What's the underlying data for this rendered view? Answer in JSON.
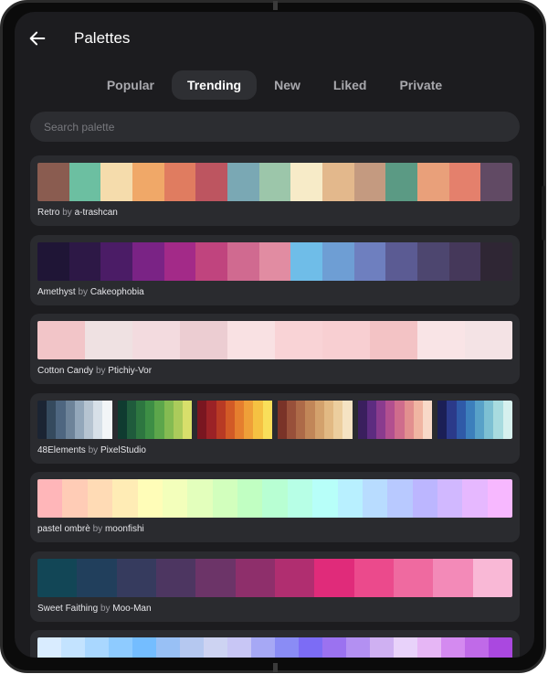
{
  "header": {
    "title": "Palettes"
  },
  "tabs": [
    {
      "label": "Popular",
      "active": false
    },
    {
      "label": "Trending",
      "active": true
    },
    {
      "label": "New",
      "active": false
    },
    {
      "label": "Liked",
      "active": false
    },
    {
      "label": "Private",
      "active": false
    }
  ],
  "search": {
    "placeholder": "Search palette",
    "value": ""
  },
  "by_word": "by",
  "palettes": [
    {
      "name": "Retro",
      "author": "a-trashcan",
      "groups": [
        [
          "#8a5c50",
          "#6cbfa1",
          "#f5dcac",
          "#f0a868",
          "#e07c60",
          "#bd5560",
          "#7aa8b4",
          "#9cc6aa",
          "#f7ebc8",
          "#e3b88c",
          "#c49a80",
          "#5b9a84",
          "#e9a07a",
          "#e4806c",
          "#614a64"
        ]
      ]
    },
    {
      "name": "Amethyst",
      "author": "Cakeophobia",
      "groups": [
        [
          "#1f1536",
          "#2d1846",
          "#4b1c66",
          "#7a2385",
          "#a32a88",
          "#c0447e",
          "#d06a90",
          "#e18ca2",
          "#6fbde8",
          "#6e9ed4",
          "#6e7fbf",
          "#5b5b93",
          "#4d466f",
          "#45385a",
          "#2f2634"
        ]
      ]
    },
    {
      "name": "Cotton Candy",
      "author": "Ptichiy-Vor",
      "groups": [
        [
          "#f2c5c8",
          "#efe1e2",
          "#f3dbdf",
          "#eccdd2",
          "#f9e1e3",
          "#f9d3d6",
          "#f8cfd2",
          "#f3c3c5",
          "#f9e4e6",
          "#f4e3e5"
        ]
      ]
    },
    {
      "name": "48Elements",
      "author": "PixelStudio",
      "groups": [
        [
          "#1b2433",
          "#354a5e",
          "#4e6680",
          "#6d8399",
          "#93a7ba",
          "#b6c4d1",
          "#d7e0e8",
          "#f2f5f7"
        ],
        [
          "#0f3b30",
          "#1f5b3c",
          "#2d7640",
          "#3d8e45",
          "#5ca64b",
          "#84bb52",
          "#abcb5b",
          "#d8df6b"
        ],
        [
          "#7a1620",
          "#9b2226",
          "#b83a24",
          "#d25a26",
          "#e57e2e",
          "#ef9f38",
          "#f5c142",
          "#f9df5a"
        ],
        [
          "#7a3328",
          "#98503a",
          "#ad6a48",
          "#c18658",
          "#d3a16c",
          "#e2b983",
          "#ecce9e",
          "#f5e3c3"
        ],
        [
          "#3a1f5e",
          "#5d2c80",
          "#8a3b8e",
          "#b24f8f",
          "#cf6c8c",
          "#e28f8f",
          "#f0b5a2",
          "#f8d9c8"
        ],
        [
          "#1b1f56",
          "#2b3a8a",
          "#2f5aa8",
          "#3c7fbc",
          "#58a1c8",
          "#7dc0d3",
          "#a8dbdf",
          "#d6f0ee"
        ]
      ]
    },
    {
      "name": "pastel ombrè",
      "author": "moonfishi",
      "groups": [
        [
          "#ffb6b9",
          "#ffccb6",
          "#ffdbb5",
          "#ffecb5",
          "#fffdb8",
          "#f3ffbb",
          "#e3ffbc",
          "#d2ffbd",
          "#c1ffc2",
          "#b8ffd3",
          "#b7ffe6",
          "#b7fff9",
          "#b8f0ff",
          "#b8dcff",
          "#b8c9ff",
          "#bcb6ff",
          "#d1b8ff",
          "#e6b8ff",
          "#f7b8ff"
        ]
      ]
    },
    {
      "name": "Sweet Faithing",
      "author": "Moo-Man",
      "groups": [
        [
          "#124656",
          "#213f5c",
          "#363b5e",
          "#4d3661",
          "#6c3468",
          "#8e2f6b",
          "#b02e70",
          "#e02b7a",
          "#eb4a8c",
          "#ef6aa0",
          "#f38ab8",
          "#f9b8d6"
        ]
      ]
    },
    {
      "name": "",
      "author": "",
      "groups": [
        [
          "#d9ecff",
          "#c3e3ff",
          "#a9d7ff",
          "#8ecbff",
          "#74bdff",
          "#98c0f5",
          "#b5c8f0",
          "#cdd3f2",
          "#c8c6f5",
          "#a6a8f5",
          "#8a8cf5",
          "#7c6cf5",
          "#9b72f0",
          "#b390f2",
          "#cfb0f2",
          "#e8d2fa",
          "#e6b6f5",
          "#d48af0",
          "#c06ae8",
          "#aa48e0"
        ]
      ]
    }
  ]
}
